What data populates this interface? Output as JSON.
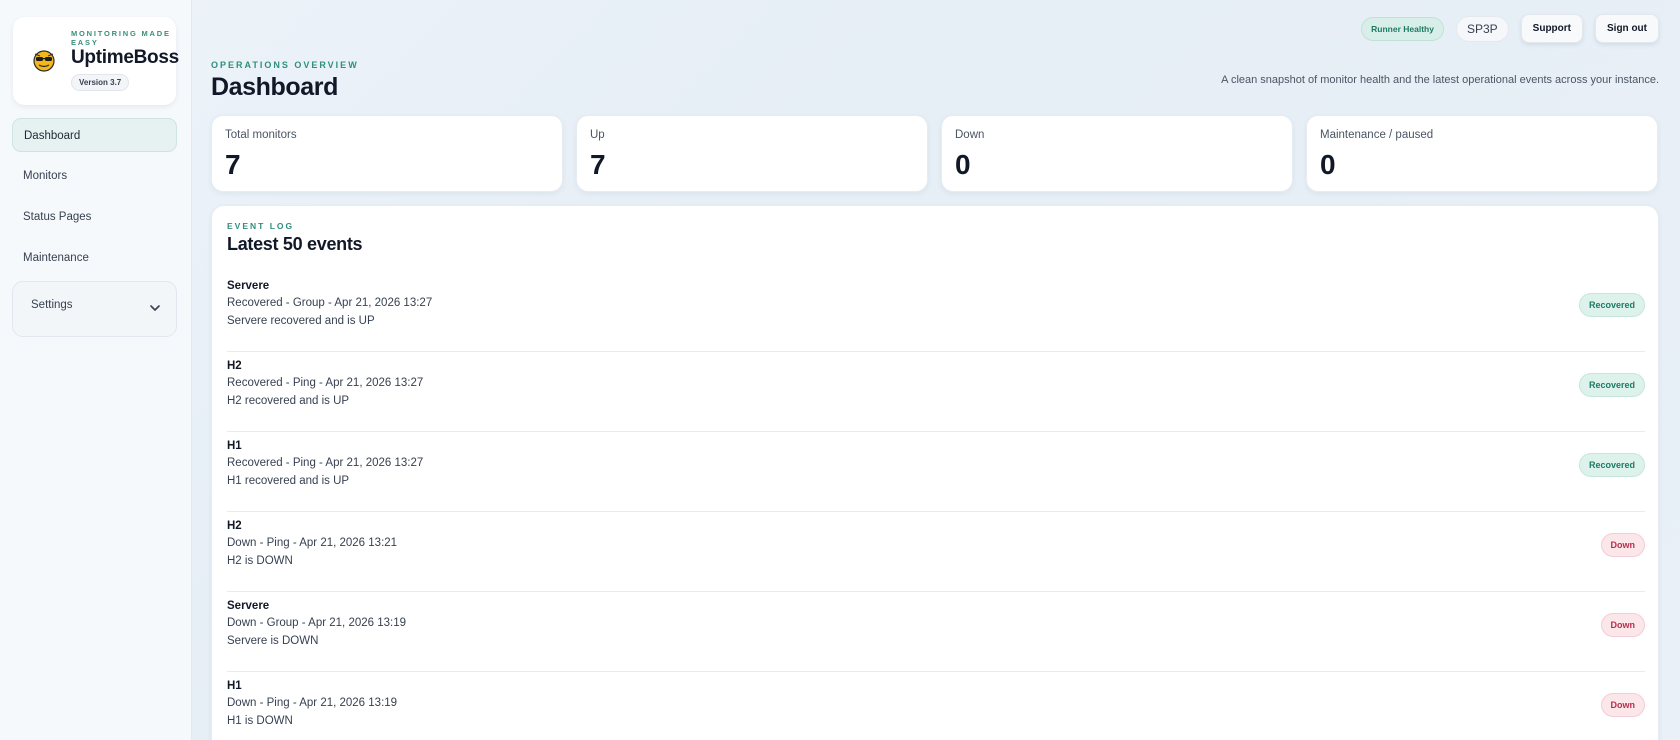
{
  "brand": {
    "tagline": "MONITORING MADE EASY",
    "name": "UptimeBoss",
    "version": "Version 3.7",
    "logo_icon": "sunglasses-emoji-icon"
  },
  "sidebar": {
    "items": [
      {
        "label": "Dashboard",
        "active": true
      },
      {
        "label": "Monitors",
        "active": false
      },
      {
        "label": "Status Pages",
        "active": false
      },
      {
        "label": "Maintenance",
        "active": false
      }
    ],
    "settings_label": "Settings"
  },
  "header": {
    "eyebrow": "OPERATIONS OVERVIEW",
    "title": "Dashboard",
    "subtitle": "A clean snapshot of monitor health and the latest operational events across your instance.",
    "runner_status": "Runner Healthy",
    "user": "SP3P",
    "support_label": "Support",
    "signout_label": "Sign out"
  },
  "stats": [
    {
      "label": "Total monitors",
      "value": "7"
    },
    {
      "label": "Up",
      "value": "7"
    },
    {
      "label": "Down",
      "value": "0"
    },
    {
      "label": "Maintenance / paused",
      "value": "0"
    }
  ],
  "event_log": {
    "eyebrow": "EVENT LOG",
    "title": "Latest 50 events",
    "events": [
      {
        "name": "Servere",
        "meta": "Recovered - Group - Apr 21, 2026 13:27",
        "message": "Servere recovered and is UP",
        "status": "Recovered"
      },
      {
        "name": "H2",
        "meta": "Recovered - Ping - Apr 21, 2026 13:27",
        "message": "H2 recovered and is UP",
        "status": "Recovered"
      },
      {
        "name": "H1",
        "meta": "Recovered - Ping - Apr 21, 2026 13:27",
        "message": "H1 recovered and is UP",
        "status": "Recovered"
      },
      {
        "name": "H2",
        "meta": "Down - Ping - Apr 21, 2026 13:21",
        "message": "H2 is DOWN",
        "status": "Down"
      },
      {
        "name": "Servere",
        "meta": "Down - Group - Apr 21, 2026 13:19",
        "message": "Servere is DOWN",
        "status": "Down"
      },
      {
        "name": "H1",
        "meta": "Down - Ping - Apr 21, 2026 13:19",
        "message": "H1 is DOWN",
        "status": "Down"
      }
    ]
  },
  "colors": {
    "accent": "#2f8f7c",
    "recovered": "#1f7a63",
    "down": "#b4314f"
  }
}
